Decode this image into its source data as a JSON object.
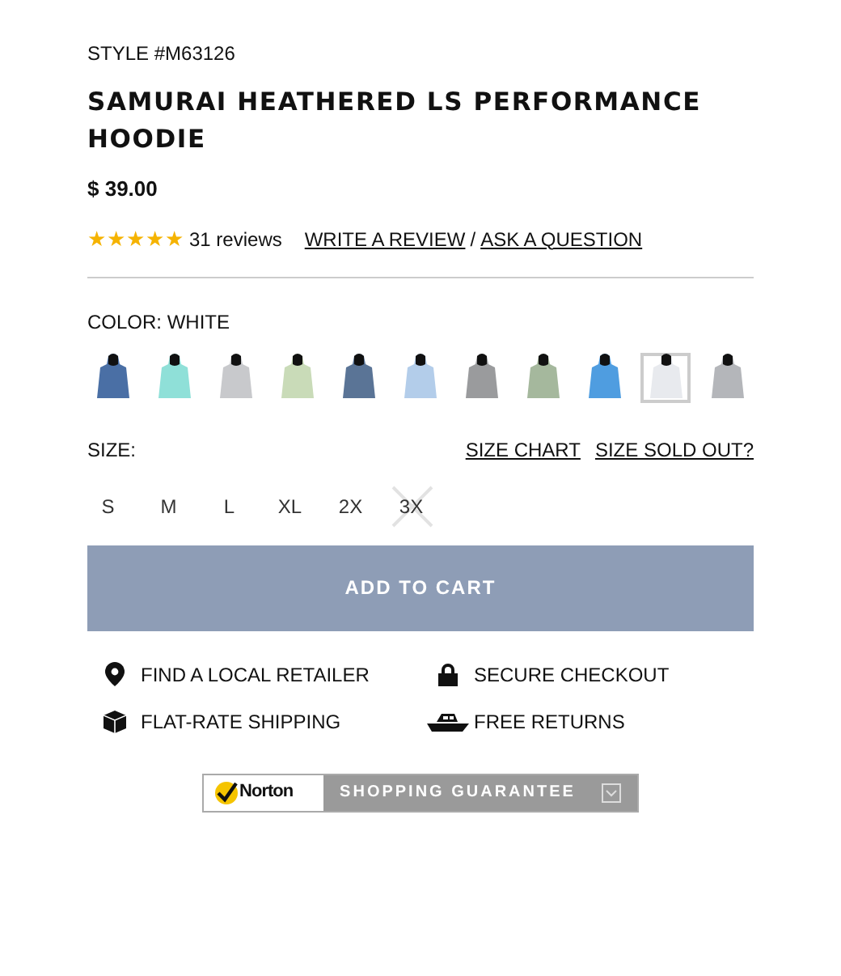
{
  "product": {
    "style": "STYLE #M63126",
    "title": "SAMURAI HEATHERED LS PERFORMANCE HOODIE",
    "price": "$ 39.00"
  },
  "rating": {
    "stars": 5,
    "reviews": "31 reviews",
    "write_review": "WRITE A REVIEW",
    "separator": "/",
    "ask_question": "ASK A QUESTION"
  },
  "color": {
    "label": "COLOR: WHITE",
    "swatches": [
      {
        "color": "#4a6fa5",
        "selected": false
      },
      {
        "color": "#8fe0d8",
        "selected": false
      },
      {
        "color": "#c8c9cc",
        "selected": false
      },
      {
        "color": "#c9dbb8",
        "selected": false
      },
      {
        "color": "#5a7496",
        "selected": false
      },
      {
        "color": "#b3cdea",
        "selected": false
      },
      {
        "color": "#9a9b9d",
        "selected": false
      },
      {
        "color": "#a5b89d",
        "selected": false
      },
      {
        "color": "#4f9de0",
        "selected": false
      },
      {
        "color": "#e8eaee",
        "selected": true
      },
      {
        "color": "#b4b6ba",
        "selected": false
      }
    ]
  },
  "size": {
    "label": "SIZE:",
    "size_chart": "SIZE CHART",
    "sold_out": "SIZE SOLD OUT?",
    "options": [
      {
        "label": "S",
        "available": true
      },
      {
        "label": "M",
        "available": true
      },
      {
        "label": "L",
        "available": true
      },
      {
        "label": "XL",
        "available": true
      },
      {
        "label": "2X",
        "available": true
      },
      {
        "label": "3X",
        "available": false
      }
    ]
  },
  "add_to_cart": {
    "label": "ADD TO CART",
    "disabled": true
  },
  "features": [
    {
      "kind": "pin",
      "label": "FIND A LOCAL RETAILER"
    },
    {
      "kind": "lock",
      "label": "SECURE CHECKOUT"
    },
    {
      "kind": "box",
      "label": "FLAT-RATE SHIPPING"
    },
    {
      "kind": "boat",
      "label": "FREE RETURNS"
    }
  ],
  "norton": {
    "brand": "Norton",
    "text": "SHOPPING GUARANTEE"
  }
}
